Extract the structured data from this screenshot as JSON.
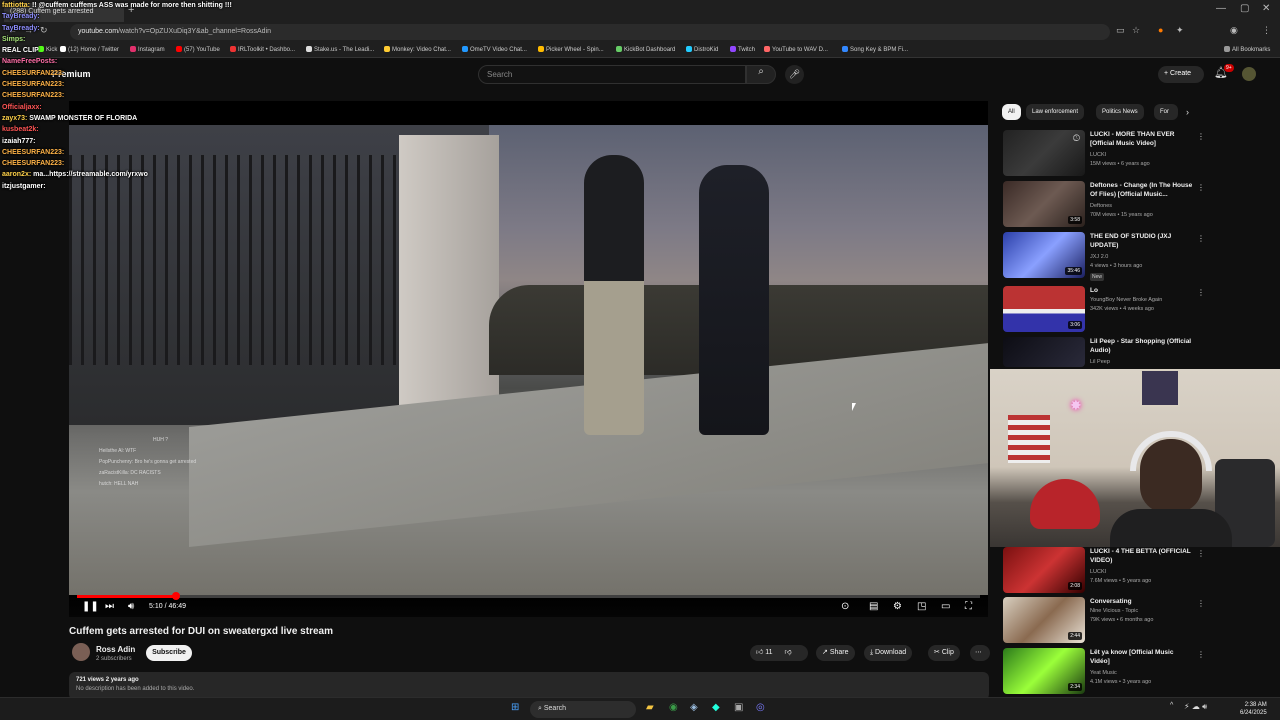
{
  "browser": {
    "tab_title": "(288) Cuffem gets arrested",
    "new_tab": "+",
    "url_domain": "youtube.com",
    "url_rest": "/watch?v=OpZUXuDiq3Y&ab_channel=RossAdin",
    "window_minimize": "—",
    "window_maximize": "▢",
    "window_close": "✕",
    "bookmarks": [
      "Kick",
      "(12) Home / Twitter",
      "Instagram",
      "(57) YouTube",
      "IRLToolkit • Dashbo...",
      "Stake.us - The Leadi...",
      "Monkey: Video Chat...",
      "OmeTV Video Chat...",
      "Picker Wheel - Spin...",
      "KickBot Dashboard",
      "DistroKid",
      "Twitch",
      "YouTube to WAV D...",
      "Song Key & BPM Fi..."
    ],
    "all_bookmarks": "All Bookmarks",
    "colors": {
      "kick": "#53fc18",
      "twitter": "#ffffff",
      "instagram": "#e1306c",
      "youtube": "#ff0000",
      "twitch": "#9146ff"
    }
  },
  "youtube": {
    "logo": "Premium",
    "search_placeholder": "Search",
    "create_label": "Create",
    "notif_count": "9+",
    "accent": "#ff0000"
  },
  "player": {
    "time_current": "5:10",
    "time_sep": " / ",
    "time_total": "46:49",
    "progress_fraction": 0.11,
    "overlay_chat": [
      "HUH ?",
      "Heilsthe Al: WTF",
      "PopPunchenry: Bro he's gonna get arrested",
      "zaRacistKilla: DC RACISTS",
      "hutch: HELL NAH"
    ]
  },
  "video": {
    "title": "Cuffem gets arrested for DUI on sweatergxd live stream",
    "channel": "Ross Adin",
    "subscribers": "2 subscribers",
    "subscribe_label": "Subscribe",
    "likes": "11",
    "share_label": "Share",
    "download_label": "Download",
    "clip_label": "Clip",
    "views_date": "721 views  2 years ago",
    "description": "No description has been added to this video."
  },
  "sidebar": {
    "chips": [
      "All",
      "Law enforcement",
      "Politics News",
      "For"
    ],
    "recommendations": [
      {
        "title": "LUCKI - MORE THAN EVER [Official Music Video]",
        "channel": "LUCKI",
        "meta": "15M views • 6 years ago",
        "duration": ""
      },
      {
        "title": "Deftones - Change (In The House Of Flies) [Official Music...",
        "channel": "Deftones",
        "meta": "70M views • 15 years ago",
        "duration": "3:58"
      },
      {
        "title": "THE END OF STUDIO (JXJ UPDATE)",
        "channel": "JXJ 2.0",
        "meta": "4 views • 3 hours ago",
        "duration": "35:46",
        "badge": "New"
      },
      {
        "title": "Lo",
        "channel": "YoungBoy Never Broke Again",
        "meta": "342K views • 4 weeks ago",
        "duration": "3:06"
      },
      {
        "title": "Lil Peep - Star Shopping (Official Audio)",
        "channel": "Lil Peep",
        "meta": "",
        "duration": ""
      },
      {
        "title": "LUCKI - 4 THE BETTA (OFFICIAL VIDEO)",
        "channel": "LUCKI",
        "meta": "7.6M views • 5 years ago",
        "duration": "2:08"
      },
      {
        "title": "Conversating",
        "channel": "Nine Vicious - Topic",
        "meta": "79K views • 6 months ago",
        "duration": "2:44"
      },
      {
        "title": "Lët ya know [Official Music Vidéo]",
        "channel": "Yeat Music",
        "meta": "4.1M views • 3 years ago",
        "duration": "2:34"
      }
    ]
  },
  "stream_chat": [
    {
      "user": "fattiotta:",
      "msg": "!! @cuffem cuffems ASS was made for more then shitting !!!",
      "color": "#ffd24a"
    },
    {
      "user": "TayBready:",
      "msg": "",
      "color": "#8f8fff"
    },
    {
      "user": "TayBready:",
      "msg": "",
      "color": "#8f8fff"
    },
    {
      "user": "Simps:",
      "msg": "",
      "color": "#a7e27a"
    },
    {
      "user": "",
      "msg": "REAL CLIP",
      "color": "#ffffff"
    },
    {
      "user": "NameFreePosts:",
      "msg": "",
      "color": "#ff6fa8"
    },
    {
      "user": "CHEESURFAN223:",
      "msg": "",
      "color": "#ffb347"
    },
    {
      "user": "CHEESURFAN223:",
      "msg": "",
      "color": "#ffb347"
    },
    {
      "user": "CHEESURFAN223:",
      "msg": "",
      "color": "#ffb347"
    },
    {
      "user": "Officialjaxx:",
      "msg": "",
      "color": "#ff5555"
    },
    {
      "user": "zayx73:",
      "msg": "SWAMP MONSTER OF FLORIDA",
      "color": "#ffd24a"
    },
    {
      "user": "kusbeat2k:",
      "msg": "",
      "color": "#ff5555"
    },
    {
      "user": "izaiah777:",
      "msg": "",
      "color": "#ffffff"
    },
    {
      "user": "CHEESURFAN223:",
      "msg": "",
      "color": "#ffb347"
    },
    {
      "user": "CHEESURFAN223:",
      "msg": "",
      "color": "#ffb347"
    },
    {
      "user": "aaron2x:",
      "msg": "ma...https://streamable.com/yrxwo",
      "color": "#ffd24a"
    },
    {
      "user": "itzjustgamer:",
      "msg": "",
      "color": "#ffffff"
    }
  ],
  "taskbar": {
    "search_label": "Search",
    "time": "2:38 AM",
    "date": "6/24/2025"
  }
}
